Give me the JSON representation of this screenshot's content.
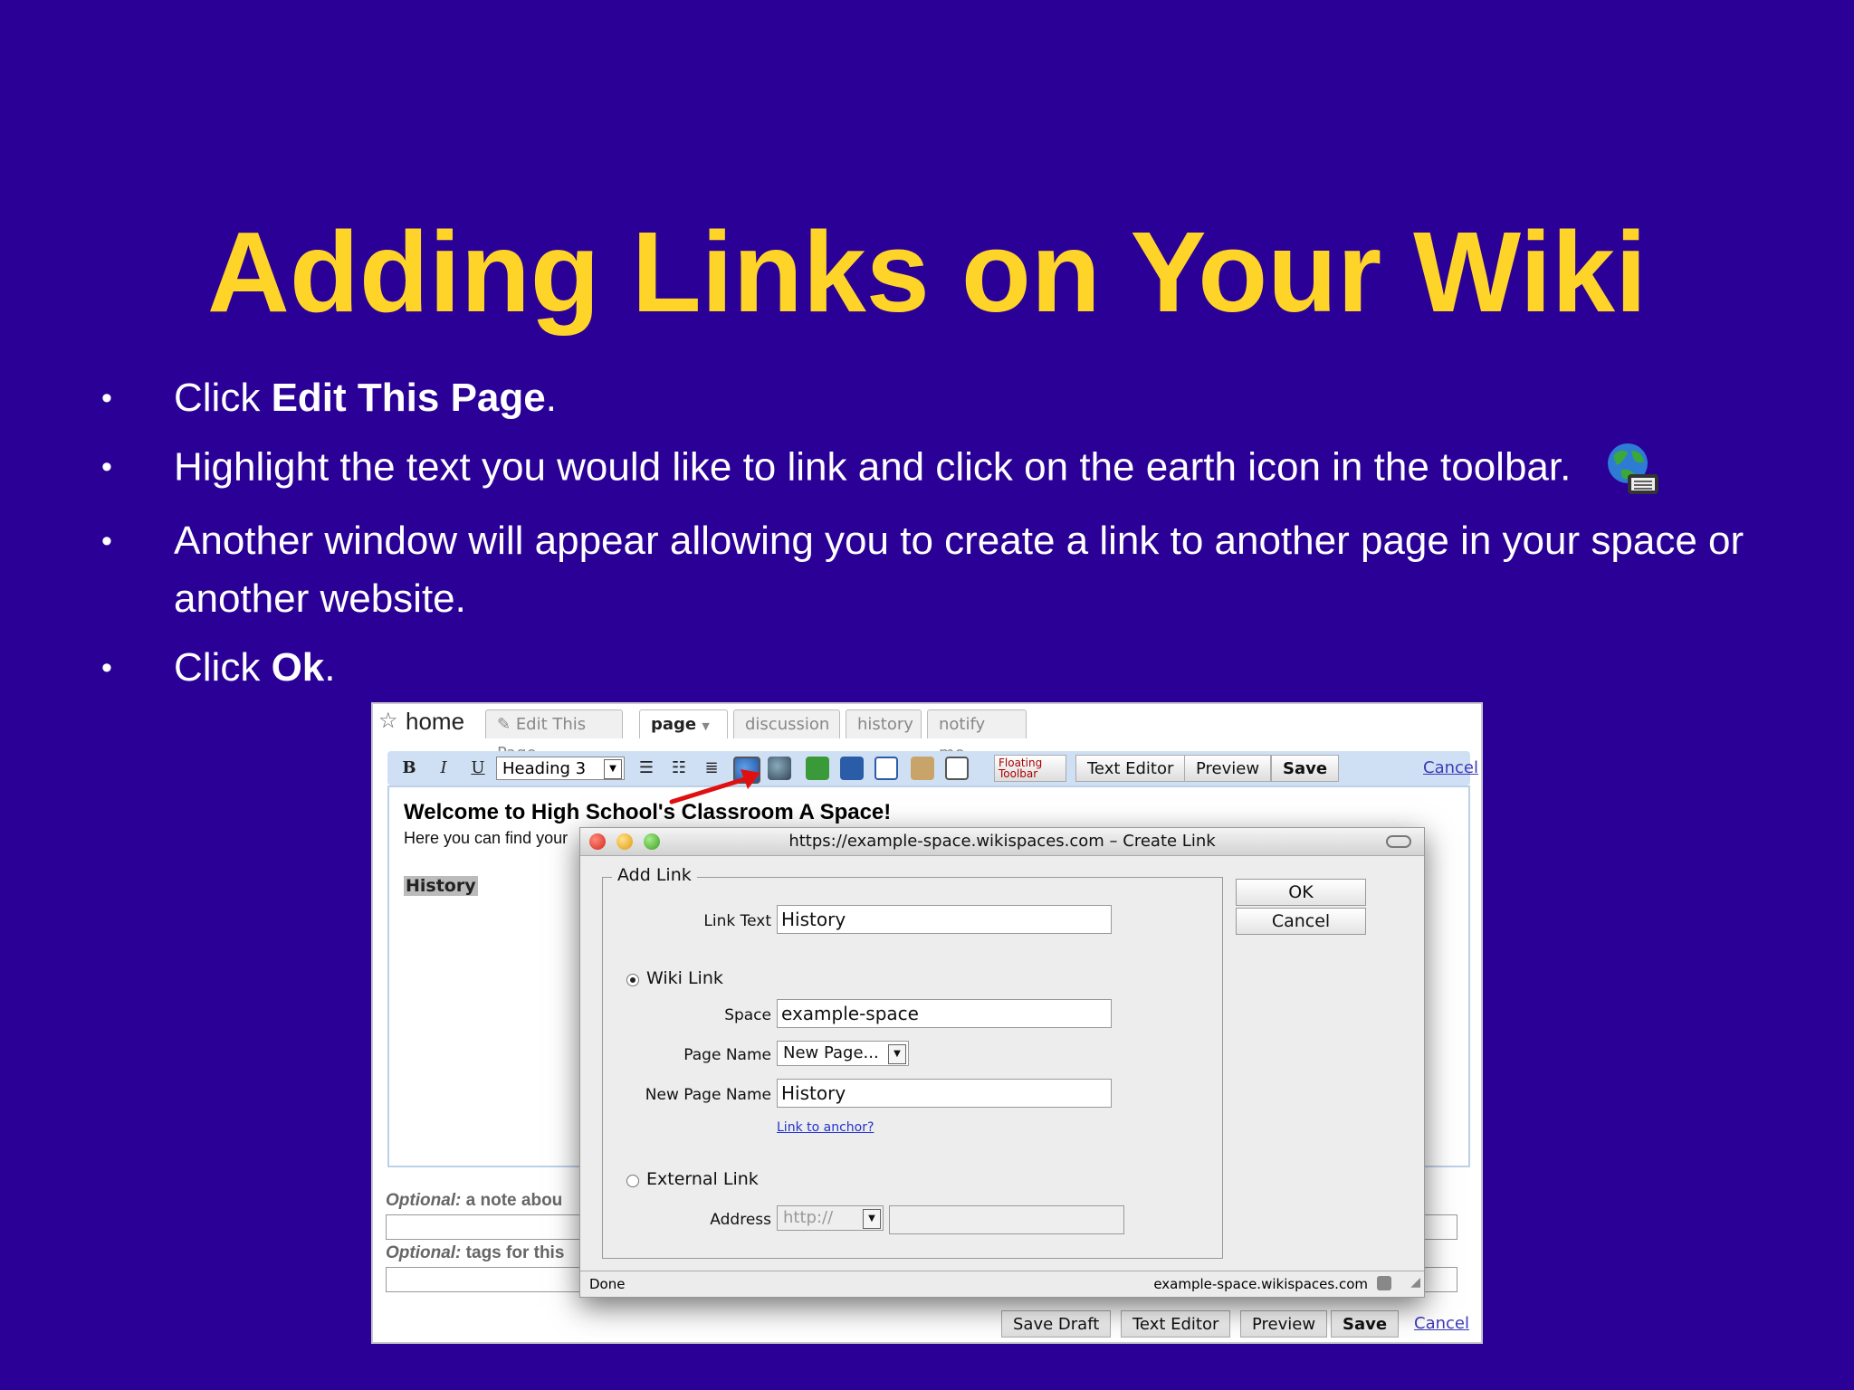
{
  "slide": {
    "title": "Adding Links on Your Wiki",
    "bullets": [
      {
        "pre": "Click ",
        "bold": "Edit This Page",
        "post": "."
      },
      {
        "pre": "Highlight the text you would like to link and click on the earth icon in the toolbar.",
        "bold": "",
        "post": ""
      },
      {
        "pre": "Another window will appear allowing you to create a link to another page in your space or another website.",
        "bold": "",
        "post": ""
      },
      {
        "pre": "Click ",
        "bold": "Ok",
        "post": "."
      }
    ],
    "bullet_char": "•"
  },
  "wiki": {
    "home_label": "home",
    "tabs": [
      "Edit This Page",
      "page",
      "discussion",
      "history",
      "notify me"
    ],
    "toolbar": {
      "bold": "B",
      "italic": "I",
      "underline": "U",
      "heading_select": "Heading 3",
      "floating_toolbar": "Floating Toolbar",
      "text_editor": "Text Editor",
      "preview": "Preview",
      "save": "Save",
      "cancel": "Cancel"
    },
    "content": {
      "heading": "Welcome to High School's Classroom A Space!",
      "intro": "Here you can find your",
      "highlight": "History"
    },
    "optional_note_label": "Optional:",
    "optional_note_text": "a note abou",
    "optional_tags_label": "Optional:",
    "optional_tags_text": "tags for this",
    "bottom": {
      "save_draft": "Save Draft",
      "text_editor": "Text Editor",
      "preview": "Preview",
      "save": "Save",
      "cancel": "Cancel"
    }
  },
  "dialog": {
    "title": "https://example-space.wikispaces.com – Create Link",
    "legend": "Add Link",
    "link_text_label": "Link Text",
    "link_text_value": "History",
    "wiki_link_label": "Wiki Link",
    "space_label": "Space",
    "space_value": "example-space",
    "page_name_label": "Page Name",
    "page_name_value": "New Page...",
    "new_page_name_label": "New Page Name",
    "new_page_name_value": "History",
    "anchor_link": "Link to anchor?",
    "external_link_label": "External Link",
    "address_label": "Address",
    "address_protocol": "http://",
    "address_value": "",
    "ok": "OK",
    "cancel": "Cancel",
    "status_left": "Done",
    "status_right": "example-space.wikispaces.com"
  },
  "colors": {
    "background": "#2a0096",
    "title": "#ffd428",
    "text": "#ffffff",
    "arrow": "#e01010"
  }
}
